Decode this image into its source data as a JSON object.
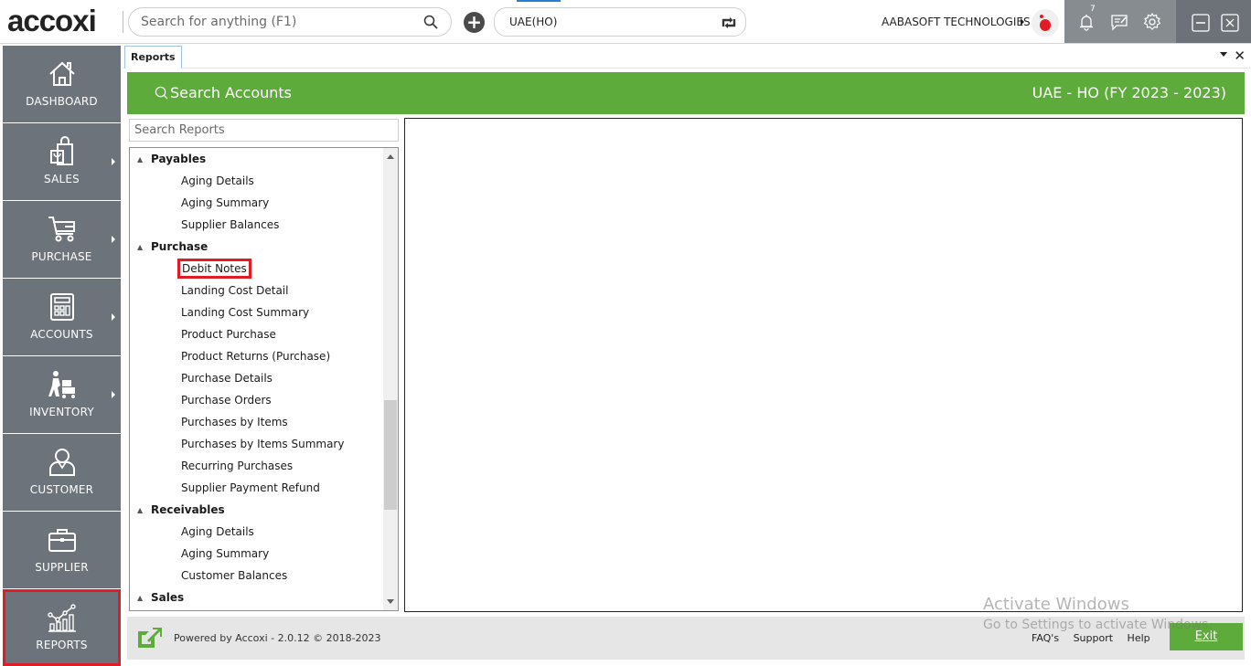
{
  "header": {
    "logo": "accoxi",
    "search_placeholder": "Search for anything (F1)",
    "company_selector": "UAE(HO)",
    "org_name": "AABASOFT TECHNOLOGIES",
    "notification_count": "7",
    "icons": [
      "search-icon",
      "add-icon",
      "refresh-icon",
      "bell-icon",
      "message-icon",
      "gear-icon",
      "minimize-icon",
      "close-icon"
    ]
  },
  "sidebar": {
    "items": [
      {
        "label": "DASHBOARD",
        "icon": "home-icon",
        "has_submenu": false
      },
      {
        "label": "SALES",
        "icon": "shopping-bag-icon",
        "has_submenu": true
      },
      {
        "label": "PURCHASE",
        "icon": "cart-icon",
        "has_submenu": true
      },
      {
        "label": "ACCOUNTS",
        "icon": "calculator-icon",
        "has_submenu": true
      },
      {
        "label": "INVENTORY",
        "icon": "worker-cart-icon",
        "has_submenu": true
      },
      {
        "label": "CUSTOMER",
        "icon": "user-icon",
        "has_submenu": false
      },
      {
        "label": "SUPPLIER",
        "icon": "briefcase-icon",
        "has_submenu": false
      },
      {
        "label": "REPORTS",
        "icon": "chart-icon",
        "has_submenu": false,
        "active": true
      }
    ]
  },
  "tabs": [
    {
      "label": "Reports",
      "active": true
    }
  ],
  "banner": {
    "search_accounts": "Search Accounts",
    "fiscal_year": "UAE - HO (FY 2023 - 2023)"
  },
  "reports": {
    "search_placeholder": "Search Reports",
    "tree": [
      {
        "type": "group",
        "label": "Payables"
      },
      {
        "type": "leaf",
        "label": "Aging Details"
      },
      {
        "type": "leaf",
        "label": "Aging Summary"
      },
      {
        "type": "leaf",
        "label": "Supplier Balances"
      },
      {
        "type": "group",
        "label": "Purchase"
      },
      {
        "type": "leaf",
        "label": "Debit Notes",
        "selected": true
      },
      {
        "type": "leaf",
        "label": "Landing Cost Detail"
      },
      {
        "type": "leaf",
        "label": "Landing Cost Summary"
      },
      {
        "type": "leaf",
        "label": "Product Purchase"
      },
      {
        "type": "leaf",
        "label": "Product Returns (Purchase)"
      },
      {
        "type": "leaf",
        "label": "Purchase Details"
      },
      {
        "type": "leaf",
        "label": "Purchase Orders"
      },
      {
        "type": "leaf",
        "label": "Purchases by Items"
      },
      {
        "type": "leaf",
        "label": "Purchases by Items Summary"
      },
      {
        "type": "leaf",
        "label": "Recurring Purchases"
      },
      {
        "type": "leaf",
        "label": "Supplier Payment Refund"
      },
      {
        "type": "group",
        "label": "Receivables"
      },
      {
        "type": "leaf",
        "label": "Aging Details"
      },
      {
        "type": "leaf",
        "label": "Aging Summary"
      },
      {
        "type": "leaf",
        "label": "Customer Balances"
      },
      {
        "type": "group",
        "label": "Sales"
      }
    ]
  },
  "footer": {
    "powered_by": "Powered by Accoxi - 2.0.12 © 2018-2023",
    "links": [
      "FAQ's",
      "Support",
      "Help"
    ],
    "exit_label": "Exit"
  },
  "watermark": {
    "line1": "Activate Windows",
    "line2": "Go to Settings to activate Windows."
  }
}
